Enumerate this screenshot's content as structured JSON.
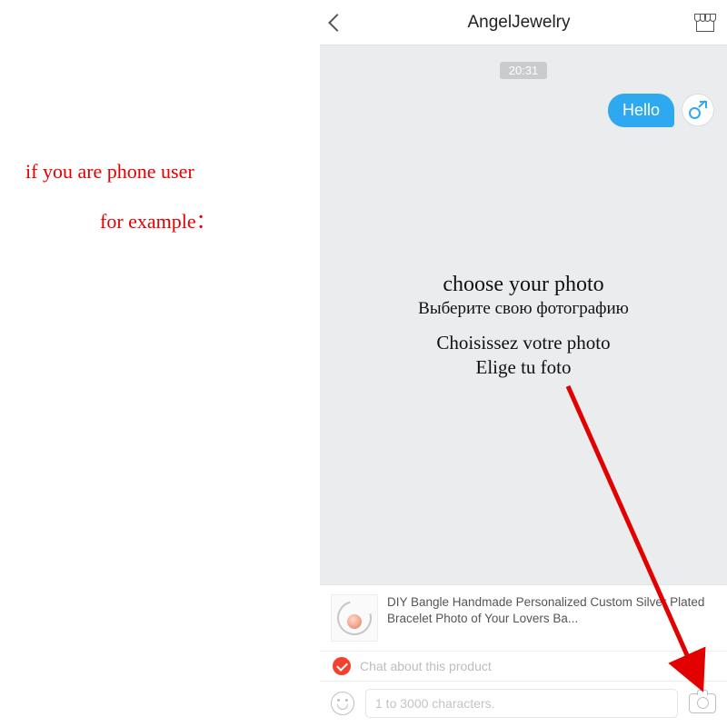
{
  "outside": {
    "line1": "if you are phone user",
    "line2": "for example："
  },
  "header": {
    "title": "AngelJewelry"
  },
  "chat": {
    "timestamp": "20:31",
    "bubble_text": "Hello"
  },
  "overlay": {
    "en": "choose your photo",
    "ru": "Выберите свою фотографию",
    "fr": "Choisissez votre photo",
    "es": "Elige tu foto"
  },
  "product": {
    "title": "DIY Bangle Handmade Personalized Custom Silver Plated Bracelet Photo of Your Lovers Ba..."
  },
  "chat_about": {
    "label": "Chat about this product"
  },
  "input": {
    "placeholder": "1 to 3000 characters."
  }
}
